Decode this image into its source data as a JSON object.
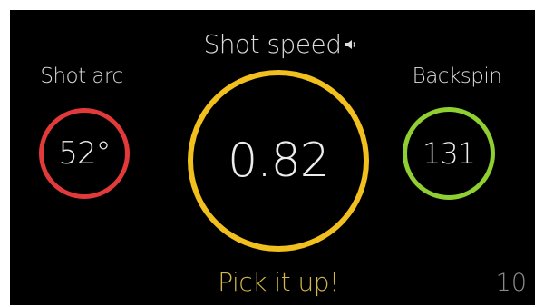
{
  "metrics": {
    "shot_arc": {
      "label": "Shot arc",
      "value": "52°",
      "color": "#e23a3a"
    },
    "shot_speed": {
      "label": "Shot speed",
      "value": "0.82",
      "color": "#f2c01e",
      "icon": "speaker-icon"
    },
    "backspin": {
      "label": "Backspin",
      "value": "131",
      "color": "#8fcf32"
    }
  },
  "feedback": {
    "message": "Pick it up!",
    "message_color": "#d1b84a"
  },
  "counter": {
    "value": "10"
  }
}
